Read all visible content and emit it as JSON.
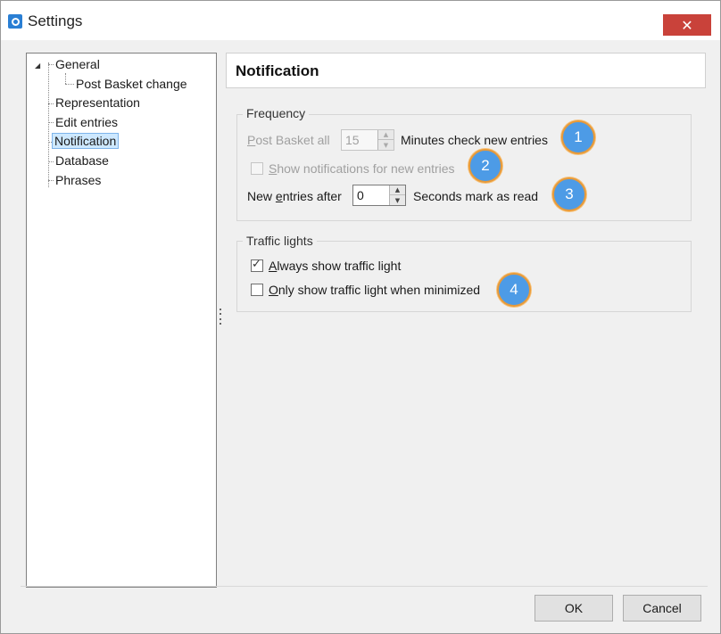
{
  "window": {
    "title": "Settings",
    "close_glyph": "✕",
    "accent_close": "#c9423a"
  },
  "tree": {
    "items": [
      {
        "label": "General",
        "expanded": true,
        "level": 0
      },
      {
        "label": "Post Basket change",
        "level": 1
      },
      {
        "label": "Representation",
        "level": 0
      },
      {
        "label": "Edit entries",
        "level": 0
      },
      {
        "label": "Notification",
        "level": 0,
        "selected": true
      },
      {
        "label": "Database",
        "level": 0
      },
      {
        "label": "Phrases",
        "level": 0
      }
    ]
  },
  "panel": {
    "title": "Notification"
  },
  "frequency": {
    "legend": "Frequency",
    "post_basket_label_acc": "P",
    "post_basket_label_rest": "ost Basket all",
    "post_basket_value": "15",
    "post_basket_suffix": "Minutes check new entries",
    "show_notif_label_acc": "S",
    "show_notif_label_rest": "how notifications for new entries",
    "show_notif_checked": false,
    "new_entries_label_pre": "New ",
    "new_entries_label_acc": "e",
    "new_entries_label_rest": "ntries after",
    "new_entries_value": "0",
    "new_entries_suffix": "Seconds mark as read"
  },
  "traffic": {
    "legend": "Traffic lights",
    "always_label_acc": "A",
    "always_label_rest": "lways show traffic light",
    "always_checked": true,
    "only_label_acc": "O",
    "only_label_rest": "nly show traffic light when minimized",
    "only_checked": false
  },
  "callouts": [
    "1",
    "2",
    "3",
    "4"
  ],
  "buttons": {
    "ok": "OK",
    "cancel": "Cancel"
  },
  "icons": {
    "app": "settings-app-icon",
    "expander": "triangle-expanded-icon",
    "spin_up": "▲",
    "spin_down": "▼",
    "check": "✓"
  }
}
